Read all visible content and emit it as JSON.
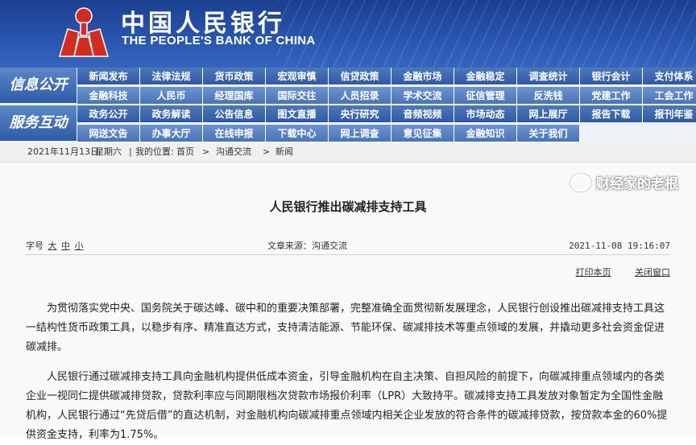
{
  "header": {
    "title_cn": "中国人民银行",
    "title_en": "THE PEOPLE'S BANK OF CHINA",
    "logo_icon": "pboc-emblem-icon",
    "colors": {
      "banner": "#2a56b0",
      "logo_red": "#d42a1f"
    }
  },
  "nav": {
    "info_label": "信息公开",
    "service_label": "服务互动",
    "rows": [
      [
        "新闻发布",
        "法律法规",
        "货币政策",
        "宏观审慎",
        "信贷政策",
        "金融市场",
        "金融稳定",
        "调查统计",
        "银行会计",
        "支付体系"
      ],
      [
        "金融科技",
        "人民币",
        "经理国库",
        "国际交往",
        "人员招录",
        "学术交流",
        "征信管理",
        "反洗钱",
        "党建工作",
        "工会工作"
      ],
      [
        "政务公开",
        "政务解读",
        "公告信息",
        "图文直播",
        "央行研究",
        "音频视频",
        "市场动态",
        "网上展厅",
        "报告下载",
        "报刊年鉴"
      ],
      [
        "网送文告",
        "办事大厅",
        "在线申报",
        "下载中心",
        "网上调查",
        "意见征集",
        "金融知识",
        "关于我们"
      ]
    ]
  },
  "breadcrumb": {
    "date": "2021年11月13日",
    "weekday": "星期六",
    "location_prefix": "我的位置:",
    "items": [
      "首页",
      "沟通交流",
      "新闻"
    ],
    "sep": ">"
  },
  "article": {
    "title": "人民银行推出碳减排支持工具",
    "font_size_label": "字号",
    "font_sizes": [
      "大",
      "中",
      "小"
    ],
    "source": "文章来源：沟通交流",
    "datetime": "2021-11-08 19:16:07",
    "print_label": "打印本页",
    "close_label": "关闭窗口",
    "paragraphs": [
      "为贯彻落实党中央、国务院关于碳达峰、碳中和的重要决策部署，完整准确全面贯彻新发展理念，人民银行创设推出碳减排支持工具这一结构性货币政策工具，以稳步有序、精准直达方式，支持清洁能源、节能环保、碳减排技术等重点领域的发展，并撬动更多社会资金促进碳减排。",
      "人民银行通过碳减排支持工具向金融机构提供低成本资金，引导金融机构在自主决策、自担风险的前提下，向碳减排重点领域内的各类企业一视同仁提供碳减排贷款，贷款利率应与同期限档次贷款市场报价利率（LPR）大致持平。碳减排支持工具发放对象暂定为全国性金融机构，人民银行通过“先贷后借”的直达机制，对金融机构向碳减排重点领域内相关企业发放的符合条件的碳减排贷款，按贷款本金的60%提供资金支持，利率为1.75%。"
    ]
  },
  "watermark": {
    "text": "财经家的老根",
    "icon": "wechat-icon"
  }
}
